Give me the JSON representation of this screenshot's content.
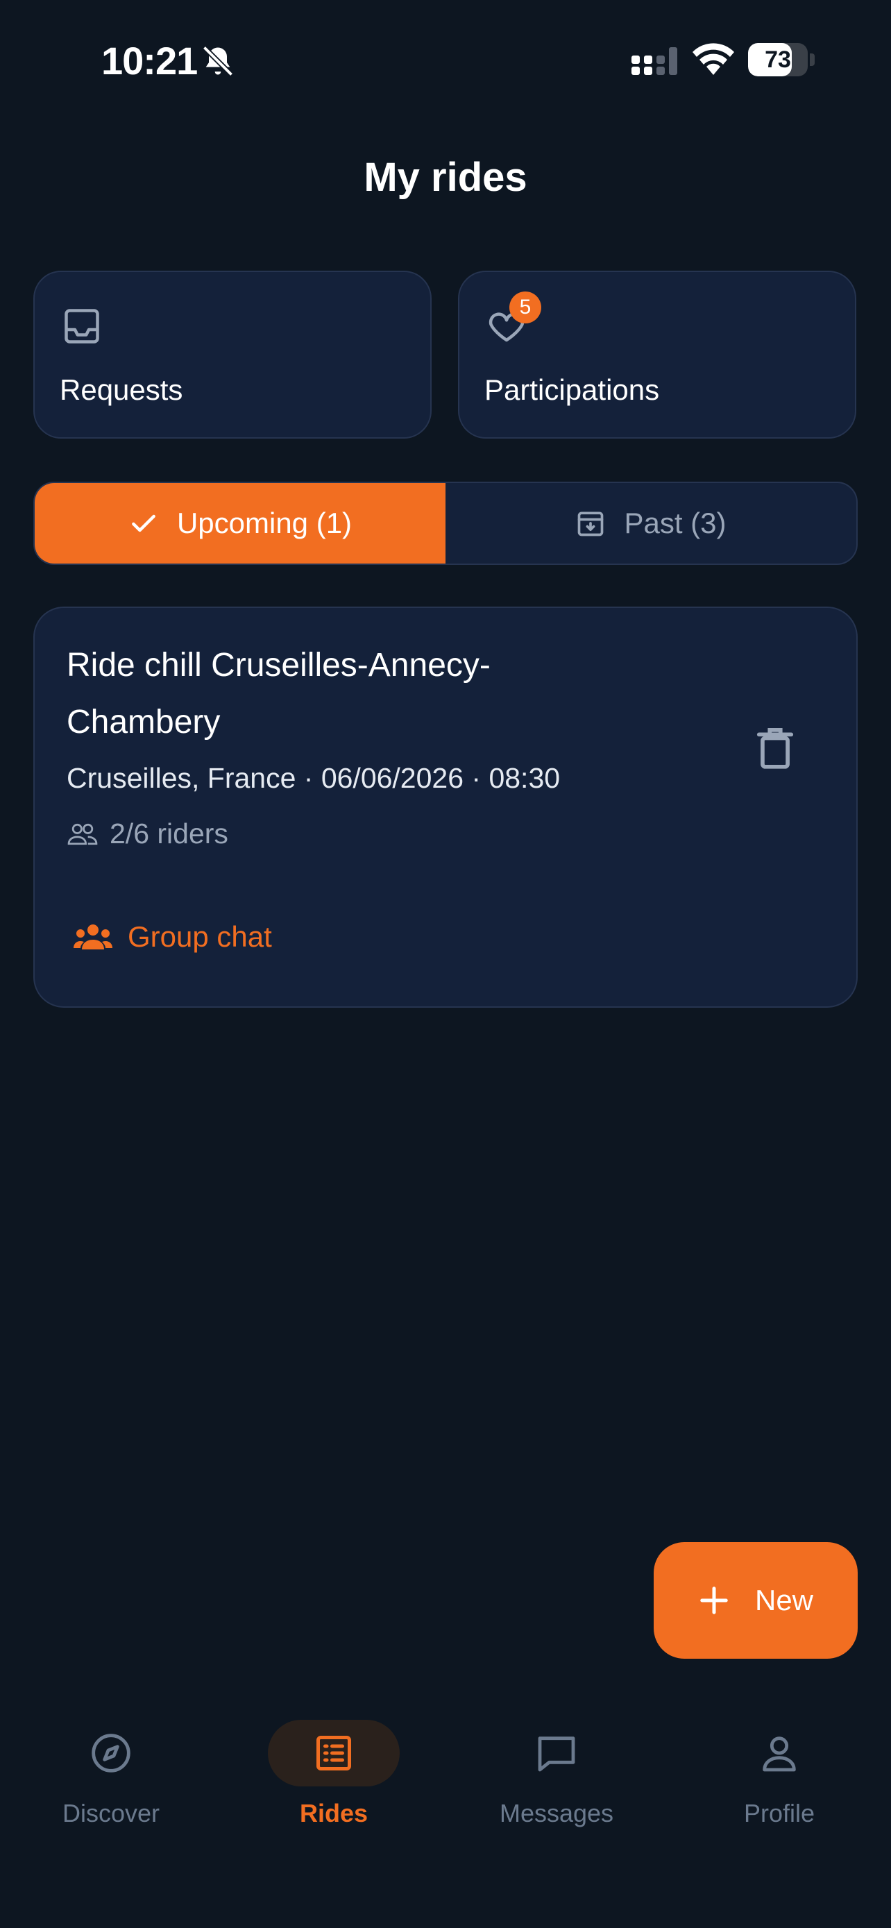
{
  "status_bar": {
    "time": "10:21",
    "battery": "73",
    "battery_level": 0.73
  },
  "header": {
    "title": "My rides"
  },
  "quick_cards": {
    "requests_label": "Requests",
    "participations_label": "Participations",
    "participations_badge": "5"
  },
  "segments": {
    "upcoming_label": "Upcoming (1)",
    "past_label": "Past (3)"
  },
  "ride": {
    "title": "Ride chill Cruseilles-Annecy-Chambery",
    "meta": "Cruseilles, France · 06/06/2026 · 08:30",
    "riders": "2/6 riders",
    "group_chat_label": "Group chat"
  },
  "fab": {
    "label": "New"
  },
  "nav": {
    "discover": "Discover",
    "rides": "Rides",
    "messages": "Messages",
    "profile": "Profile"
  },
  "colors": {
    "accent": "#f26e21",
    "background": "#0d1621",
    "card": "#14213a"
  }
}
